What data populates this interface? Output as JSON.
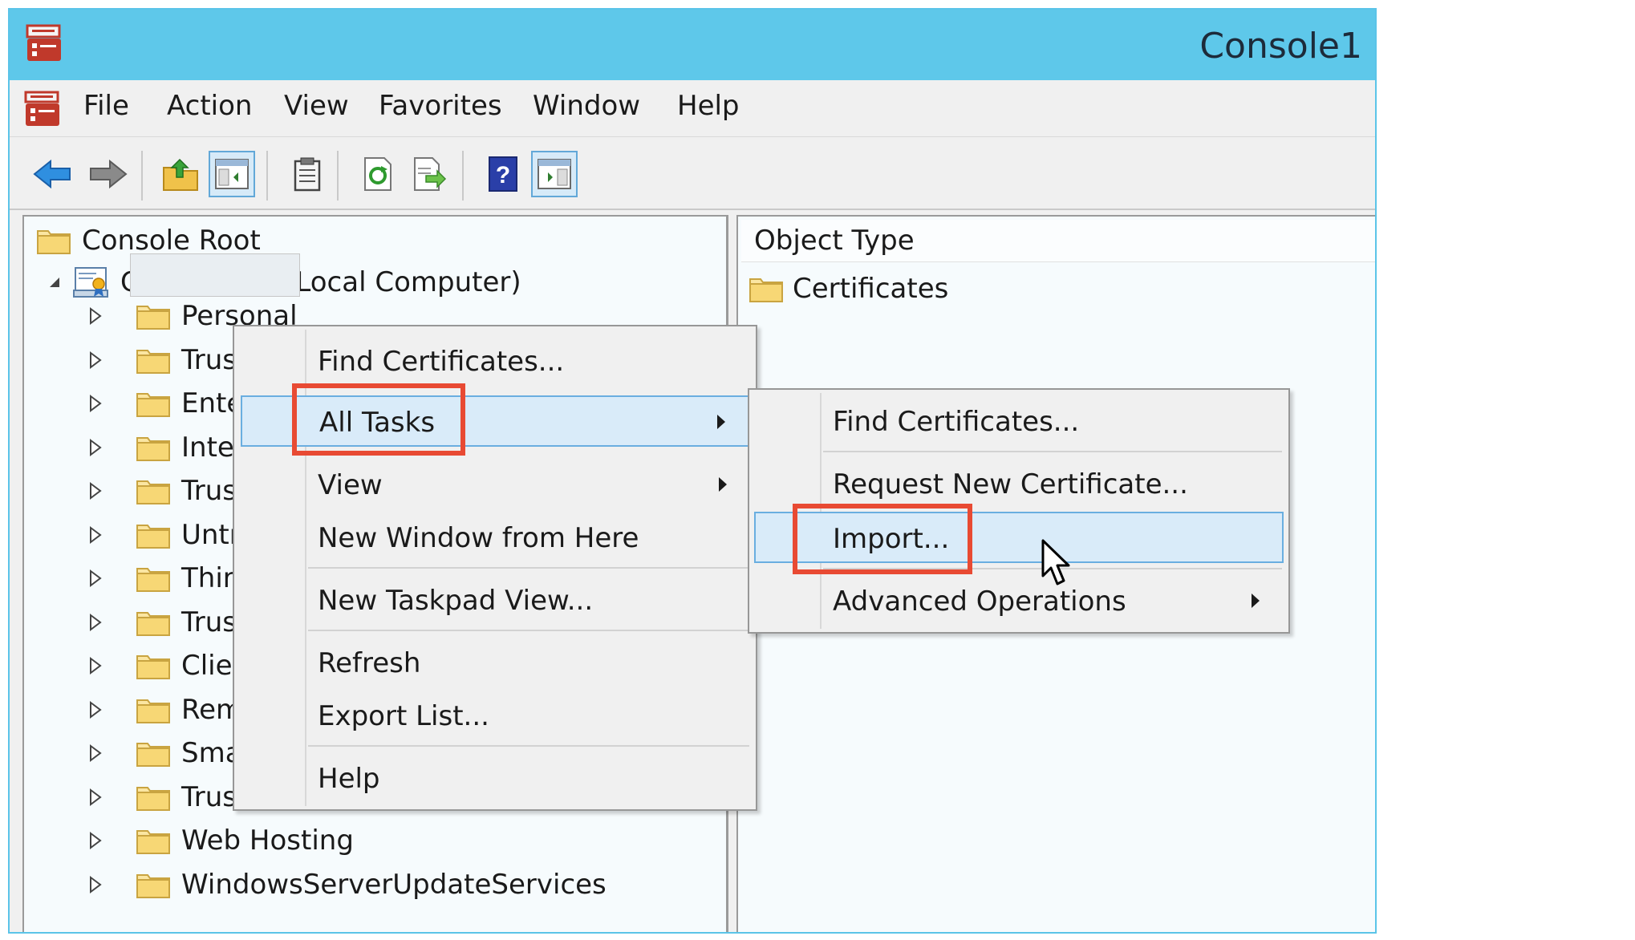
{
  "window": {
    "title": "Console1"
  },
  "menubar": {
    "items": [
      "File",
      "Action",
      "View",
      "Favorites",
      "Window",
      "Help"
    ]
  },
  "toolbar": {
    "icons": [
      "back-arrow-icon",
      "forward-arrow-icon",
      "up-folder-icon",
      "show-hide-console-tree-icon",
      "properties-clipboard-icon",
      "refresh-icon",
      "export-list-icon",
      "help-icon",
      "show-hide-action-pane-icon"
    ]
  },
  "tree": {
    "root": "Console Root",
    "certificates": "Certificates (Local Computer)",
    "children": [
      "Personal",
      "Trus",
      "Ente",
      "Inter",
      "Trus",
      "Untr",
      "Thirc",
      "Trus",
      "Clier",
      "Rem",
      "Sma",
      "Trus",
      "Web Hosting",
      "WindowsServerUpdateServices"
    ]
  },
  "right_pane": {
    "column_header": "Object Type",
    "rows": [
      "Certificates"
    ]
  },
  "context_menu": {
    "find_certificates": "Find Certificates...",
    "all_tasks": "All Tasks",
    "view": "View",
    "new_window": "New Window from Here",
    "new_taskpad": "New Taskpad View...",
    "refresh": "Refresh",
    "export_list": "Export List...",
    "help": "Help"
  },
  "submenu": {
    "find_certificates": "Find Certificates...",
    "request_new": "Request New Certificate...",
    "import": "Import...",
    "advanced_operations": "Advanced Operations"
  },
  "colors": {
    "titlebar": "#5ec8ea",
    "highlight": "#d9ebf9",
    "callout": "#e84a33"
  }
}
